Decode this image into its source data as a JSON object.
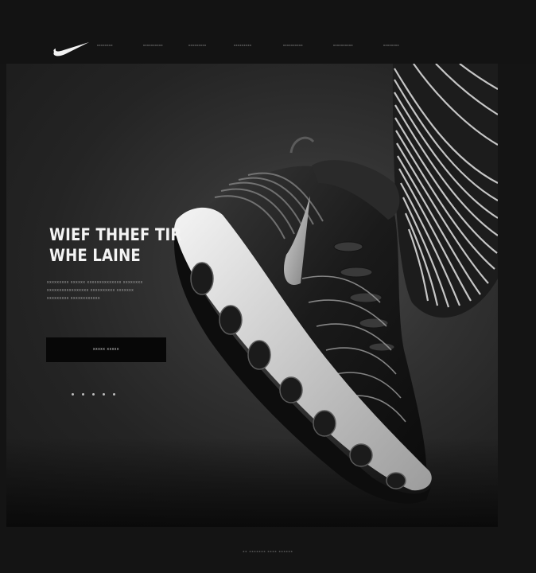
{
  "nav": {
    "logo": "swoosh-logo",
    "items": [
      {
        "label": "xxxxxxxx"
      },
      {
        "label": "xxxxxxxxxx"
      },
      {
        "label": "xxxxxxxxx"
      },
      {
        "label": "xxxxxxxxx"
      },
      {
        "label": "xxxxxxxxxx"
      },
      {
        "label": "xxxxxxxxxx"
      },
      {
        "label": "xxxxxxxx"
      }
    ]
  },
  "hero": {
    "headline_line1": "WIEF THHEF TIR",
    "headline_line2": "WHE LAINE",
    "body_lines": [
      "xxxxxxxxx xxxxxx xxxxxxxxxxxxxx xxxxxxxx",
      "xxxxxxxxxxxxxxxxx xxxxxxxxxx xxxxxxx",
      "xxxxxxxxx xxxxxxxxxxxx"
    ],
    "cta_label": "xxxxx xxxxx",
    "slider_dots": 5,
    "colors": {
      "accent": "#ffffff",
      "background": "#141414",
      "button": "#070707"
    }
  },
  "footer": {
    "text": "xx xxxxxxx  xxxx  xxxxxx"
  }
}
